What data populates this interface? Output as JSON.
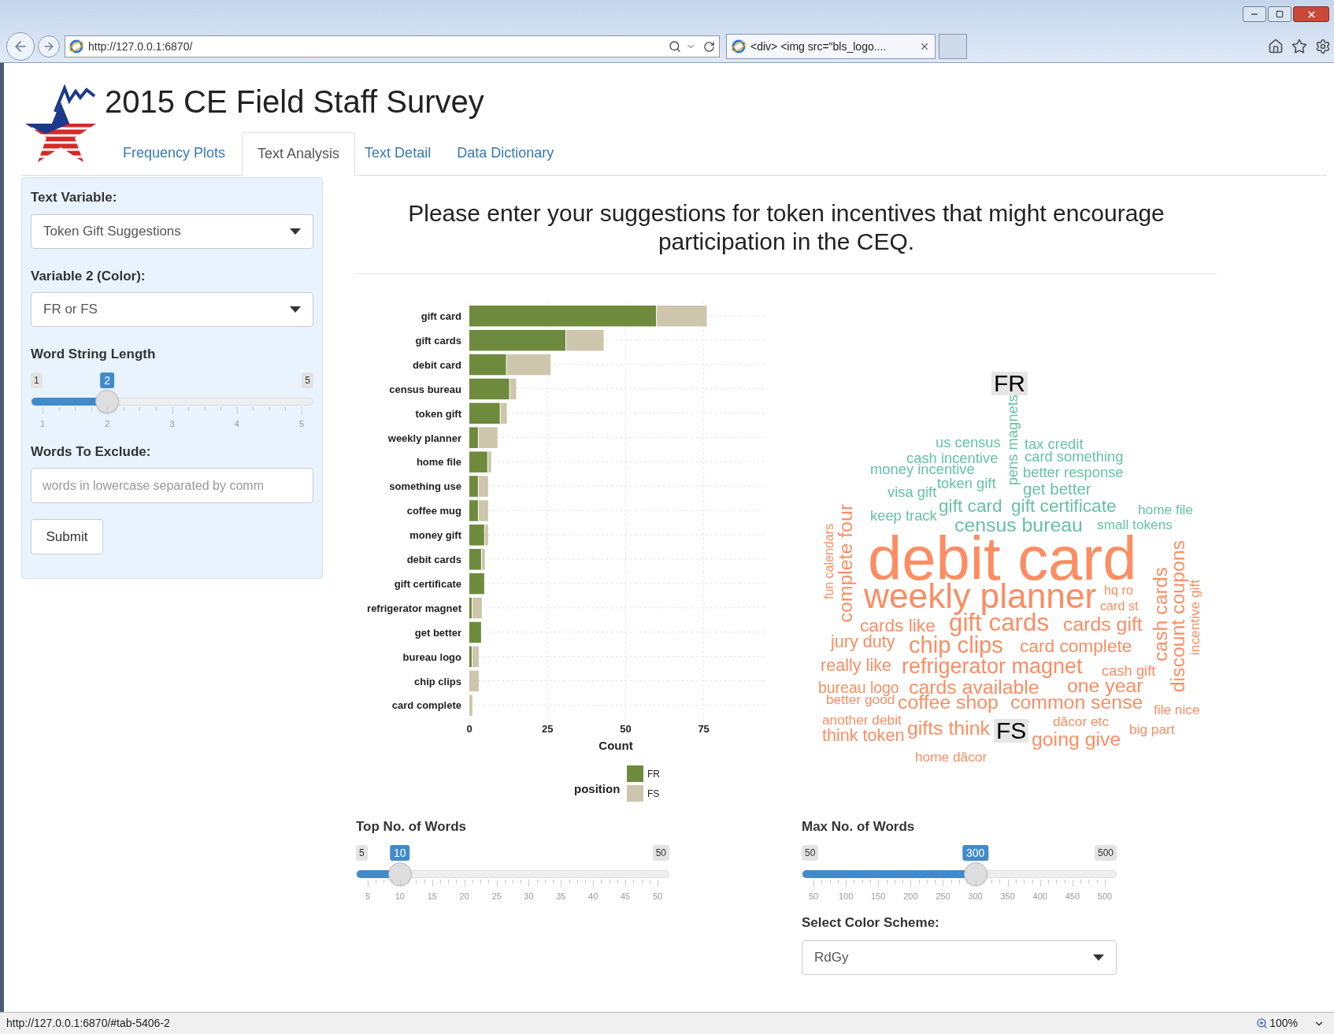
{
  "browser": {
    "address": "http://127.0.0.1:6870/",
    "tab_title": "<div> <img src=\"bls_logo....",
    "status_url": "http://127.0.0.1:6870/#tab-5406-2",
    "zoom": "100%"
  },
  "app": {
    "title": "2015 CE Field Staff Survey",
    "tabs": [
      {
        "label": "Frequency Plots",
        "selected": false
      },
      {
        "label": "Text Analysis",
        "selected": true
      },
      {
        "label": "Text Detail",
        "selected": false
      },
      {
        "label": "Data Dictionary",
        "selected": false
      }
    ]
  },
  "sidebar": {
    "text_variable": {
      "label": "Text Variable:",
      "value": "Token Gift Suggestions"
    },
    "color_variable": {
      "label": "Variable 2 (Color):",
      "value": "FR or FS"
    },
    "word_length": {
      "label": "Word String Length",
      "min": "1",
      "max": "5",
      "value": "2",
      "level": 0.25,
      "ticks": [
        "1",
        "2",
        "3",
        "4",
        "5"
      ]
    },
    "exclude": {
      "label": "Words To Exclude:",
      "placeholder": "words in lowercase separated by comm"
    },
    "submit": "Submit"
  },
  "main": {
    "question": "Please enter your suggestions for token incentives that might encourage participation in the CEQ.",
    "bar_chart": {
      "chart_data": {
        "type": "bar",
        "orientation": "horizontal",
        "stacked": true,
        "grid": true,
        "legend": {
          "title": "position"
        },
        "xlabel": "Count",
        "xlim": [
          0,
          95
        ],
        "xticks": [
          0,
          25,
          50,
          75
        ],
        "categories": [
          "gift card",
          "gift cards",
          "debit card",
          "census bureau",
          "token gift",
          "weekly planner",
          "home file",
          "something use",
          "coffee mug",
          "money gift",
          "debit cards",
          "gift certificate",
          "refrigerator magnet",
          "get better",
          "bureau logo",
          "chip clips",
          "card complete"
        ],
        "series": [
          {
            "name": "FR",
            "color": "#6e8b3d",
            "values": [
              60,
              31,
              12,
              13,
              10,
              3,
              6,
              3,
              3,
              5,
              4,
              5,
              1,
              4,
              1,
              0,
              0
            ]
          },
          {
            "name": "FS",
            "color": "#cdc6ad",
            "values": [
              16,
              12,
              14,
              2,
              2,
              6,
              1,
              3,
              3,
              1,
              1,
              0,
              3,
              0,
              2,
              3,
              1
            ]
          }
        ]
      }
    },
    "word_cloud": {
      "groups": [
        {
          "label": "FR",
          "color": "#66c2a5",
          "words": [
            "pens magnets",
            "us census",
            "tax credit",
            "cash incentive",
            "card something",
            "money incentive",
            "better response",
            "visa gift",
            "token gift",
            "get better",
            "keep track",
            "gift card",
            "gift certificate",
            "home file",
            "census bureau",
            "small tokens"
          ]
        },
        {
          "label": "FS",
          "color": "#fc8d62",
          "words": [
            "fun calendars",
            "complete four",
            "debit card",
            "weekly planner",
            "hq ro",
            "card st",
            "cards like",
            "gift cards",
            "cards gift",
            "jury duty",
            "chip clips",
            "card complete",
            "really like",
            "refrigerator magnet",
            "cash gift",
            "cash cards",
            "discount coupons",
            "incentive gift",
            "bureau logo",
            "cards available",
            "one year",
            "better good",
            "coffee shop",
            "common sense",
            "another debit",
            "file nice",
            "think token",
            "gifts think",
            "dãcor etc",
            "going give",
            "big part",
            "home dãcor"
          ]
        }
      ]
    },
    "top_words": {
      "label": "Top No. of Words",
      "min": "5",
      "max": "50",
      "value": "10",
      "level": 0.111,
      "ticks": [
        "5",
        "10",
        "15",
        "20",
        "25",
        "30",
        "35",
        "40",
        "45",
        "50"
      ]
    },
    "max_words": {
      "label": "Max No. of Words",
      "min": "50",
      "max": "500",
      "value": "300",
      "level": 0.556,
      "ticks": [
        "50",
        "100",
        "150",
        "200",
        "250",
        "300",
        "350",
        "400",
        "450",
        "500"
      ]
    },
    "color_scheme": {
      "label": "Select Color Scheme:",
      "value": "RdGy"
    }
  }
}
